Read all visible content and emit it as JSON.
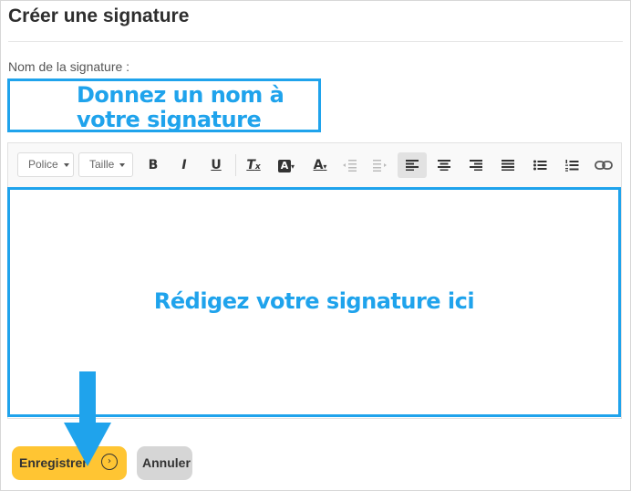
{
  "page": {
    "title": "Créer une signature"
  },
  "form": {
    "name_label": "Nom de la signature :",
    "name_hint": "Donnez un nom à\nvotre signature",
    "body_hint": "Rédigez votre signature ici"
  },
  "toolbar": {
    "font_label": "Police",
    "size_label": "Taille",
    "bold": "B",
    "italic": "I",
    "underline": "U",
    "clear_format": "T",
    "bg_color": "A",
    "text_color": "A"
  },
  "actions": {
    "save_label": "Enregistrer",
    "cancel_label": "Annuler"
  },
  "colors": {
    "accent_blue": "#1fa3ec",
    "save_yellow": "#ffc533",
    "cancel_gray": "#d6d6d6"
  }
}
